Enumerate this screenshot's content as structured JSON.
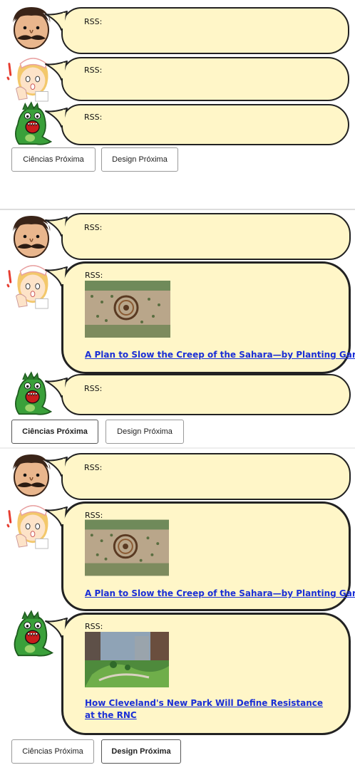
{
  "icons": {
    "man": "mustache-man-icon",
    "nurse": "nurse-girl-icon",
    "monster": "green-monster-icon"
  },
  "colors": {
    "bubble_fill": "#fff6c8",
    "link": "#1a2fd6"
  },
  "panels": [
    {
      "bubbles": [
        {
          "rss_label": "RSS:"
        },
        {
          "rss_label": "RSS:"
        },
        {
          "rss_label": "RSS:"
        }
      ],
      "buttons": {
        "ciencias": "Ciências Próxima",
        "design": "Design Próxima"
      }
    },
    {
      "bubbles": [
        {
          "rss_label": "RSS:"
        },
        {
          "rss_label": "RSS:",
          "article_title": "A Plan to Slow the Creep of the Sahara—by Planting Gardens"
        },
        {
          "rss_label": "RSS:"
        }
      ],
      "buttons": {
        "ciencias": "Ciências Próxima",
        "design": "Design Próxima"
      }
    },
    {
      "bubbles": [
        {
          "rss_label": "RSS:"
        },
        {
          "rss_label": "RSS:",
          "article_title": "A Plan to Slow the Creep of the Sahara—by Planting Gardens"
        },
        {
          "rss_label": "RSS:",
          "article_title": "How Cleveland's New Park Will Define Resistance at the RNC"
        }
      ],
      "buttons": {
        "ciencias": "Ciências Próxima",
        "design": "Design Próxima"
      }
    }
  ]
}
